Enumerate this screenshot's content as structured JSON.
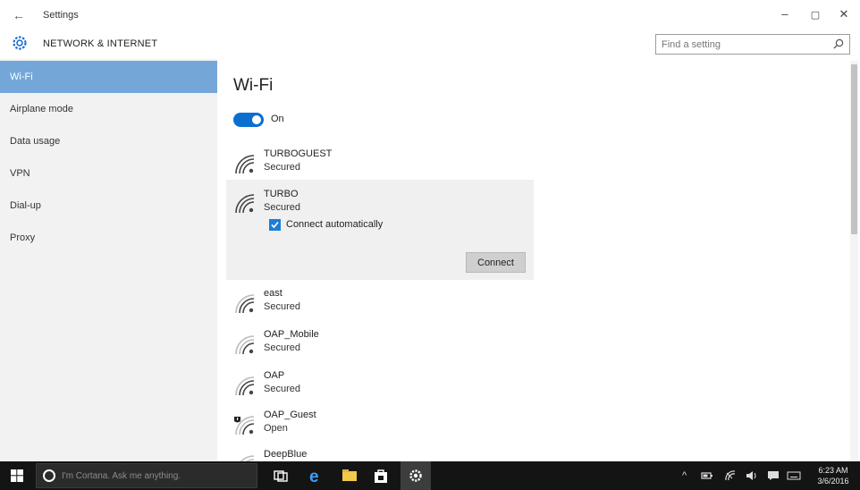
{
  "window": {
    "app_title": "Settings",
    "back_glyph": "←",
    "minimize_glyph": "–",
    "maximize_glyph": "▢",
    "close_glyph": "✕"
  },
  "header": {
    "section_title": "NETWORK & INTERNET",
    "search_placeholder": "Find a setting"
  },
  "sidebar": {
    "items": [
      {
        "label": "Wi-Fi",
        "active": true
      },
      {
        "label": "Airplane mode",
        "active": false
      },
      {
        "label": "Data usage",
        "active": false
      },
      {
        "label": "VPN",
        "active": false
      },
      {
        "label": "Dial-up",
        "active": false
      },
      {
        "label": "Proxy",
        "active": false
      }
    ]
  },
  "main": {
    "page_title": "Wi-Fi",
    "toggle_label": "On",
    "toggle_on": true,
    "networks": [
      {
        "ssid": "TURBOGUEST",
        "status": "Secured"
      },
      {
        "ssid": "TURBO",
        "status": "Secured",
        "selected": true,
        "connect_auto_label": "Connect automatically",
        "connect_auto_checked": true,
        "connect_button": "Connect"
      },
      {
        "ssid": "east",
        "status": "Secured"
      },
      {
        "ssid": "OAP_Mobile",
        "status": "Secured"
      },
      {
        "ssid": "OAP",
        "status": "Secured"
      },
      {
        "ssid": "OAP_Guest",
        "status": "Open"
      },
      {
        "ssid": "DeepBlue",
        "status": ""
      }
    ]
  },
  "taskbar": {
    "cortana_placeholder": "I'm Cortana. Ask me anything.",
    "tray_chevron": "^",
    "clock_time": "6:23 AM",
    "clock_date": "3/6/2016"
  },
  "colors": {
    "accent": "#0b6fcf",
    "sidebar_active": "#74a7d8",
    "sidebar_bg": "#f2f2f2",
    "taskbar_bg": "#141414"
  }
}
